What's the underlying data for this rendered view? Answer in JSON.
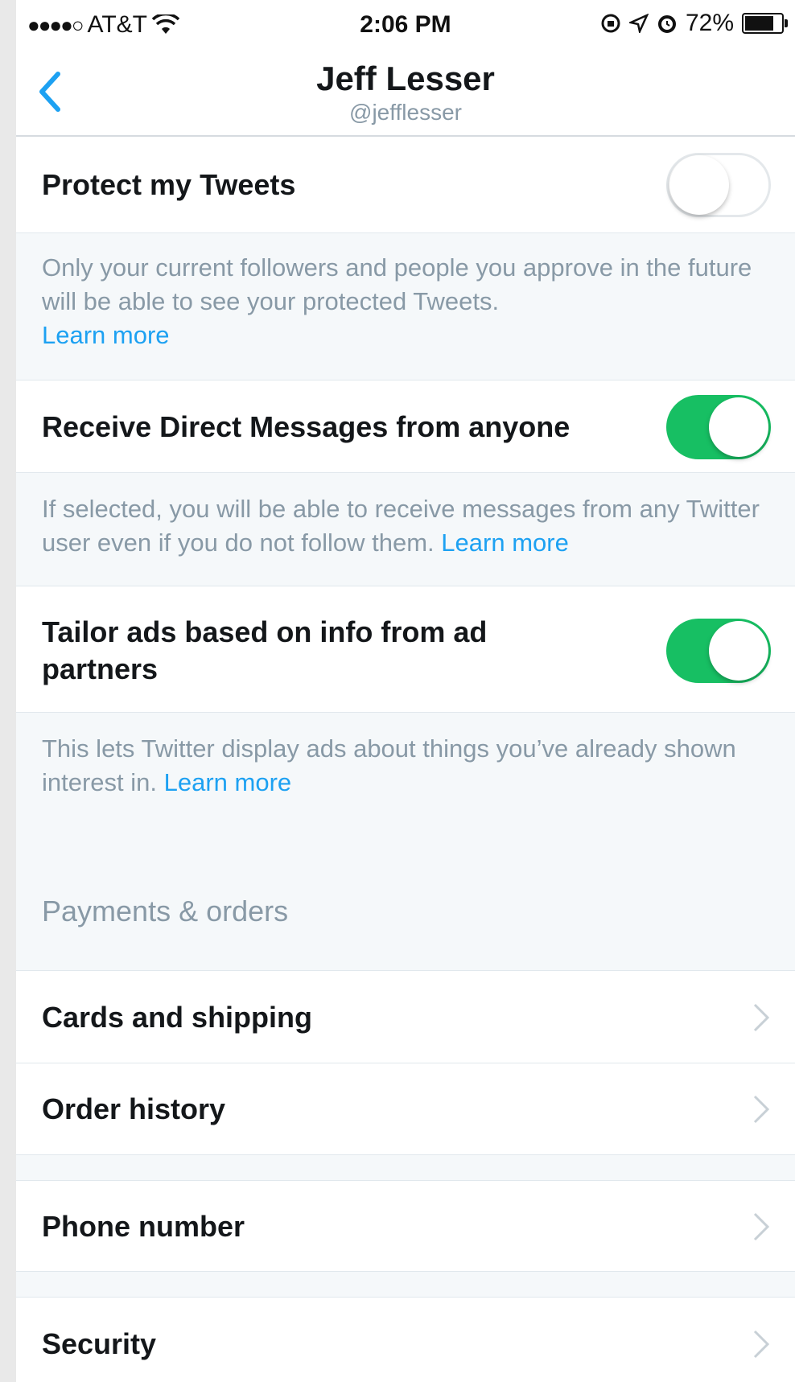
{
  "status_bar": {
    "carrier": "AT&T",
    "signal_dots": "●●●●○",
    "time": "2:06 PM",
    "battery": "72%"
  },
  "nav": {
    "title": "Jeff Lesser",
    "subtitle": "@jefflesser"
  },
  "privacy": {
    "protect": {
      "label": "Protect my Tweets",
      "enabled": false,
      "description": "Only your current followers and people you approve in the future will be able to see your protected Tweets.",
      "link": "Learn more"
    },
    "direct_messages": {
      "label": "Receive Direct Messages from anyone",
      "enabled": true,
      "description": "If selected, you will be able to receive messages from any Twitter user even if you do not follow them.",
      "link": "Learn more"
    },
    "tailor_ads": {
      "label_line1": "Tailor ads based on info from ad",
      "label_line2": "partners",
      "enabled": true,
      "description": "This lets Twitter display ads about things you’ve already shown interest in.",
      "link": "Learn more"
    }
  },
  "payments": {
    "section_title": "Payments & orders",
    "items": [
      {
        "label": "Cards and shipping"
      },
      {
        "label": "Order history"
      }
    ]
  },
  "account": {
    "items": [
      {
        "label": "Phone number"
      },
      {
        "label": "Security"
      }
    ]
  },
  "colors": {
    "accent": "#1da1f2",
    "toggle_on": "#17bf63",
    "muted_text": "#8899a6",
    "background": "#f5f8fa"
  }
}
